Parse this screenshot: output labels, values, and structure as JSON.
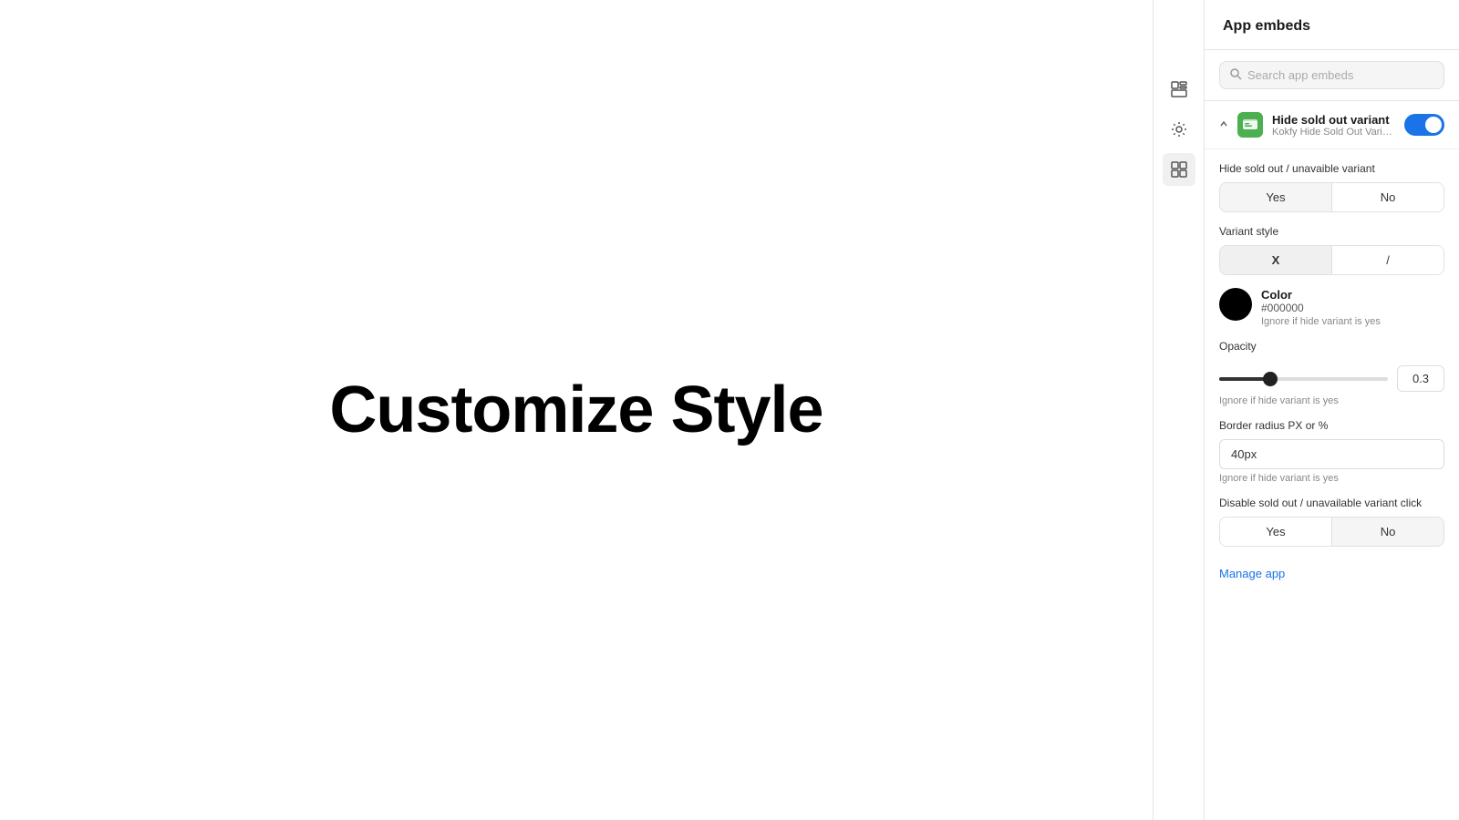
{
  "main": {
    "title": "Customize Style"
  },
  "sidebar_icons": {
    "layout_icon": "⊞",
    "settings_icon": "⚙",
    "apps_icon": "⊞"
  },
  "panel": {
    "title": "App embeds",
    "search": {
      "placeholder": "Search app embeds",
      "value": ""
    },
    "embed": {
      "app_name": "Hide sold out variant",
      "app_sub": "Kokfy Hide Sold Out Varia...",
      "toggle_on": true,
      "sections": {
        "hide_variant": {
          "label": "Hide sold out / unavaible variant",
          "yes_label": "Yes",
          "no_label": "No",
          "selected": "yes"
        },
        "variant_style": {
          "label": "Variant style",
          "x_label": "X",
          "slash_label": "/",
          "selected": "x"
        },
        "color": {
          "label": "Color",
          "hex": "#000000",
          "note": "Ignore if hide variant is yes",
          "swatch_color": "#000000"
        },
        "opacity": {
          "label": "Opacity",
          "value": "0.3",
          "note": "Ignore if hide variant is yes",
          "fill_percent": 30
        },
        "border_radius": {
          "label": "Border radius PX or %",
          "value": "40px",
          "note": "Ignore if hide variant is yes"
        },
        "disable_click": {
          "label": "Disable sold out / unavailable variant click",
          "yes_label": "Yes",
          "no_label": "No",
          "selected": "no"
        }
      },
      "manage_link": "Manage app"
    }
  }
}
